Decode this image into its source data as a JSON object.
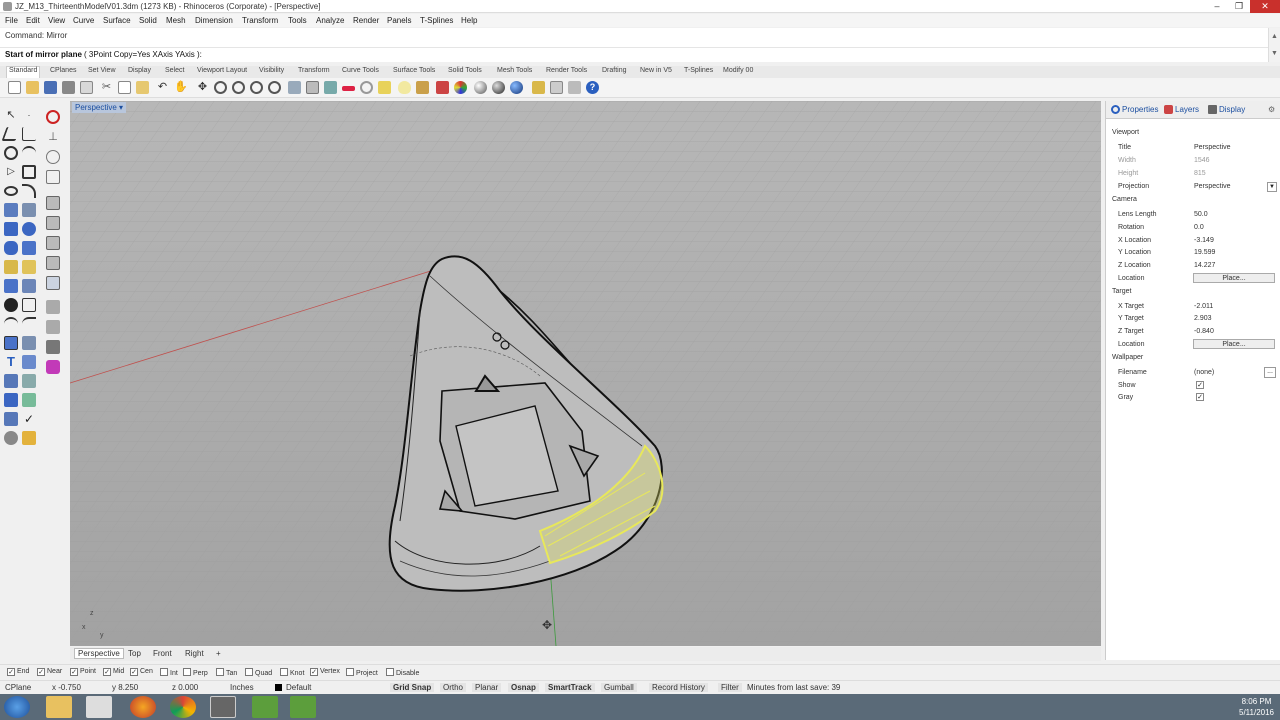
{
  "window": {
    "title": "JZ_M13_ThirteenthModelV01.3dm (1273 KB) - Rhinoceros (Corporate) - [Perspective]"
  },
  "menu": [
    "File",
    "Edit",
    "View",
    "Curve",
    "Surface",
    "Solid",
    "Mesh",
    "Dimension",
    "Transform",
    "Tools",
    "Analyze",
    "Render",
    "Panels",
    "T-Splines",
    "Help"
  ],
  "command": {
    "history": "Command: Mirror",
    "prompt": "Start of mirror plane",
    "options": "( 3Point  Copy=Yes  XAxis  YAxis ):"
  },
  "toolbar_tabs": [
    "Standard",
    "CPlanes",
    "Set View",
    "Display",
    "Select",
    "Viewport Layout",
    "Visibility",
    "Transform",
    "Curve Tools",
    "Surface Tools",
    "Solid Tools",
    "Mesh Tools",
    "Render Tools",
    "Drafting",
    "New in V5",
    "T-Splines",
    "Modify 00"
  ],
  "viewport": {
    "label": "Perspective",
    "tabs": [
      "Perspective",
      "Top",
      "Front",
      "Right"
    ],
    "add_tab": "+"
  },
  "panel": {
    "tabs": [
      "Properties",
      "Layers",
      "Display"
    ],
    "viewport_section": "Viewport",
    "title_label": "Title",
    "title_value": "Perspective",
    "width_label": "Width",
    "width_value": "1546",
    "height_label": "Height",
    "height_value": "815",
    "projection_label": "Projection",
    "projection_value": "Perspective",
    "camera_section": "Camera",
    "lens_label": "Lens Length",
    "lens_value": "50.0",
    "rotation_label": "Rotation",
    "rotation_value": "0.0",
    "xloc_label": "X Location",
    "xloc_value": "-3.149",
    "yloc_label": "Y Location",
    "yloc_value": "19.599",
    "zloc_label": "Z Location",
    "zloc_value": "14.227",
    "location_label": "Location",
    "place_button": "Place...",
    "target_section": "Target",
    "xt_label": "X Target",
    "xt_value": "-2.011",
    "yt_label": "Y Target",
    "yt_value": "2.903",
    "zt_label": "Z Target",
    "zt_value": "-0.840",
    "tloc_label": "Location",
    "tplace_button": "Place...",
    "wallpaper_section": "Wallpaper",
    "filename_label": "Filename",
    "filename_value": "(none)",
    "show_label": "Show",
    "gray_label": "Gray"
  },
  "osnaps": [
    {
      "label": "End",
      "checked": true
    },
    {
      "label": "Near",
      "checked": true
    },
    {
      "label": "Point",
      "checked": true
    },
    {
      "label": "Mid",
      "checked": true
    },
    {
      "label": "Cen",
      "checked": true
    },
    {
      "label": "Int",
      "checked": false
    },
    {
      "label": "Perp",
      "checked": false
    },
    {
      "label": "Tan",
      "checked": false
    },
    {
      "label": "Quad",
      "checked": false
    },
    {
      "label": "Knot",
      "checked": false
    },
    {
      "label": "Vertex",
      "checked": true
    },
    {
      "label": "Project",
      "checked": false
    },
    {
      "label": "Disable",
      "checked": false
    }
  ],
  "status": {
    "cplane": "CPlane",
    "x": "x -0.750",
    "y": "y 8.250",
    "z": "z 0.000",
    "units": "Inches",
    "layer": "Default",
    "grid_snap": "Grid Snap",
    "ortho": "Ortho",
    "planar": "Planar",
    "osnap": "Osnap",
    "smarttrack": "SmartTrack",
    "gumball": "Gumball",
    "record_history": "Record History",
    "filter": "Filter",
    "last_save": "Minutes from last save: 39"
  },
  "clock": {
    "time": "8:06 PM",
    "date": "5/11/2016"
  },
  "colors": {
    "accent": "#1c4fa0",
    "selection": "#e8e85a",
    "viewport_bg": "#a9a9a9"
  }
}
